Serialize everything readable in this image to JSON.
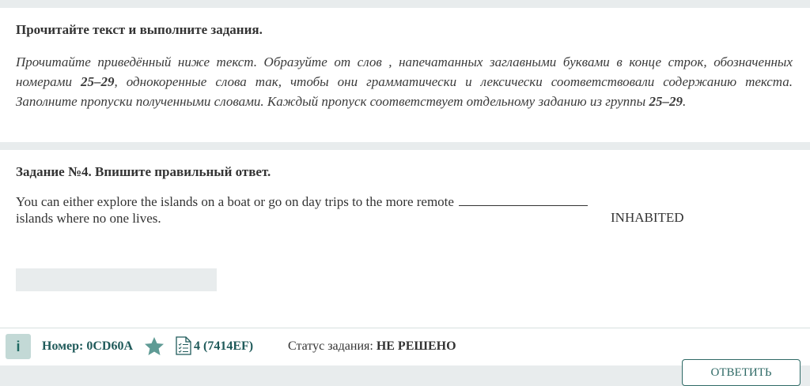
{
  "intro": {
    "heading": "Прочитайте текст и выполните задания.",
    "instruction_part1": "Прочитайте приведённый ниже текст. Образуйте от слов , напечатанных заглавными буквами в конце строк, обозначенных номерами ",
    "range1": "25–29",
    "instruction_part2": ", однокоренные слова так, чтобы они грамматически и лексически соответствовали содержанию текста. Заполните пропуски полученными словами. Каждый пропуск соответствует отдельному заданию из группы ",
    "range2": "25–29",
    "instruction_part3": "."
  },
  "task": {
    "heading": "Задание №4. Впишите правильный ответ.",
    "sentence_part1": "You can either explore the islands on a boat or go on day trips to the more remote ",
    "sentence_part2": "islands where no one lives.",
    "keyword": "INHABITED",
    "answer_value": ""
  },
  "footer": {
    "info_label": "i",
    "number_text": "Номер: 0CD60A",
    "variant_text": "4 (7414EF)",
    "status_label": "Статус задания: ",
    "status_value": "НЕ РЕШЕНО"
  },
  "actions": {
    "reply_label": "ОТВЕТИТЬ"
  },
  "colors": {
    "accent": "#1f5a5a",
    "star": "#5f9b95",
    "background": "#e8eced"
  },
  "icons": {
    "info": "info-icon",
    "star": "star-icon",
    "document": "document-list-icon"
  }
}
